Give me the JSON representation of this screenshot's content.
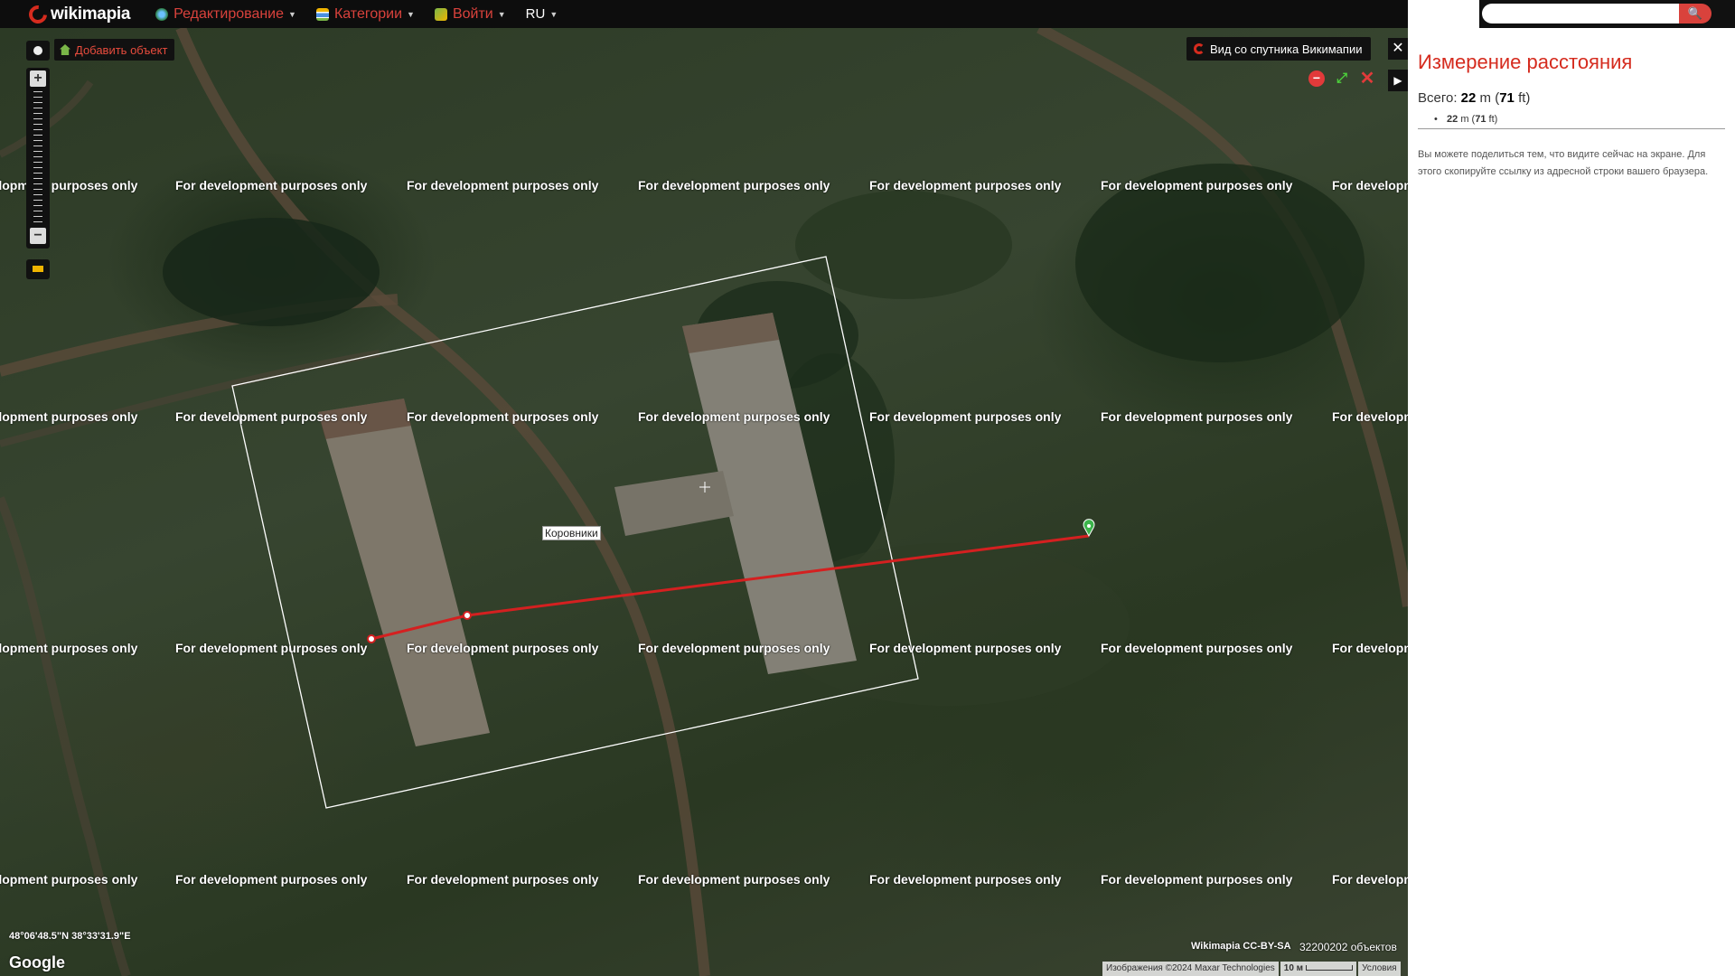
{
  "topbar": {
    "logo": "wikimapia",
    "menu": [
      {
        "label": "Редактирование",
        "icon": "globe-icon"
      },
      {
        "label": "Категории",
        "icon": "categories-icon"
      },
      {
        "label": "Войти",
        "icon": "login-icon"
      },
      {
        "label": "RU",
        "icon": ""
      }
    ]
  },
  "map": {
    "watermark": "For development purposes only",
    "label": "Коровники",
    "add_object": "Добавить объект",
    "satellite_view": "Вид со спутника Викимапии",
    "coords": "48°06'48.5\"N 38°33'31.9\"E",
    "google": "Google",
    "license": "Wikimapia CC-BY-SA",
    "object_count": "32200202 объектов",
    "attribution": {
      "imagery": "Изображения ©2024 Maxar Technologies",
      "scale": "10 м",
      "terms": "Условия"
    },
    "measure_ctrls": [
      "−",
      "⤢",
      "✕"
    ]
  },
  "panel": {
    "search": {
      "placeholder": "",
      "value": ""
    },
    "title": "Измерение расстояния",
    "total_label": "Всего:",
    "total_m": "22",
    "total_m_unit": "m",
    "total_ft": "71",
    "total_ft_unit": "ft",
    "segments": [
      {
        "m": "22",
        "ft": "71"
      }
    ],
    "note": "Вы можете поделиться тем, что видите сейчас на экране. Для этого скопируйте ссылку из адресной строки вашего браузера."
  },
  "colors": {
    "accent": "#d52b1e",
    "topbar": "#0d0d0d",
    "measure_line": "#d42020"
  }
}
